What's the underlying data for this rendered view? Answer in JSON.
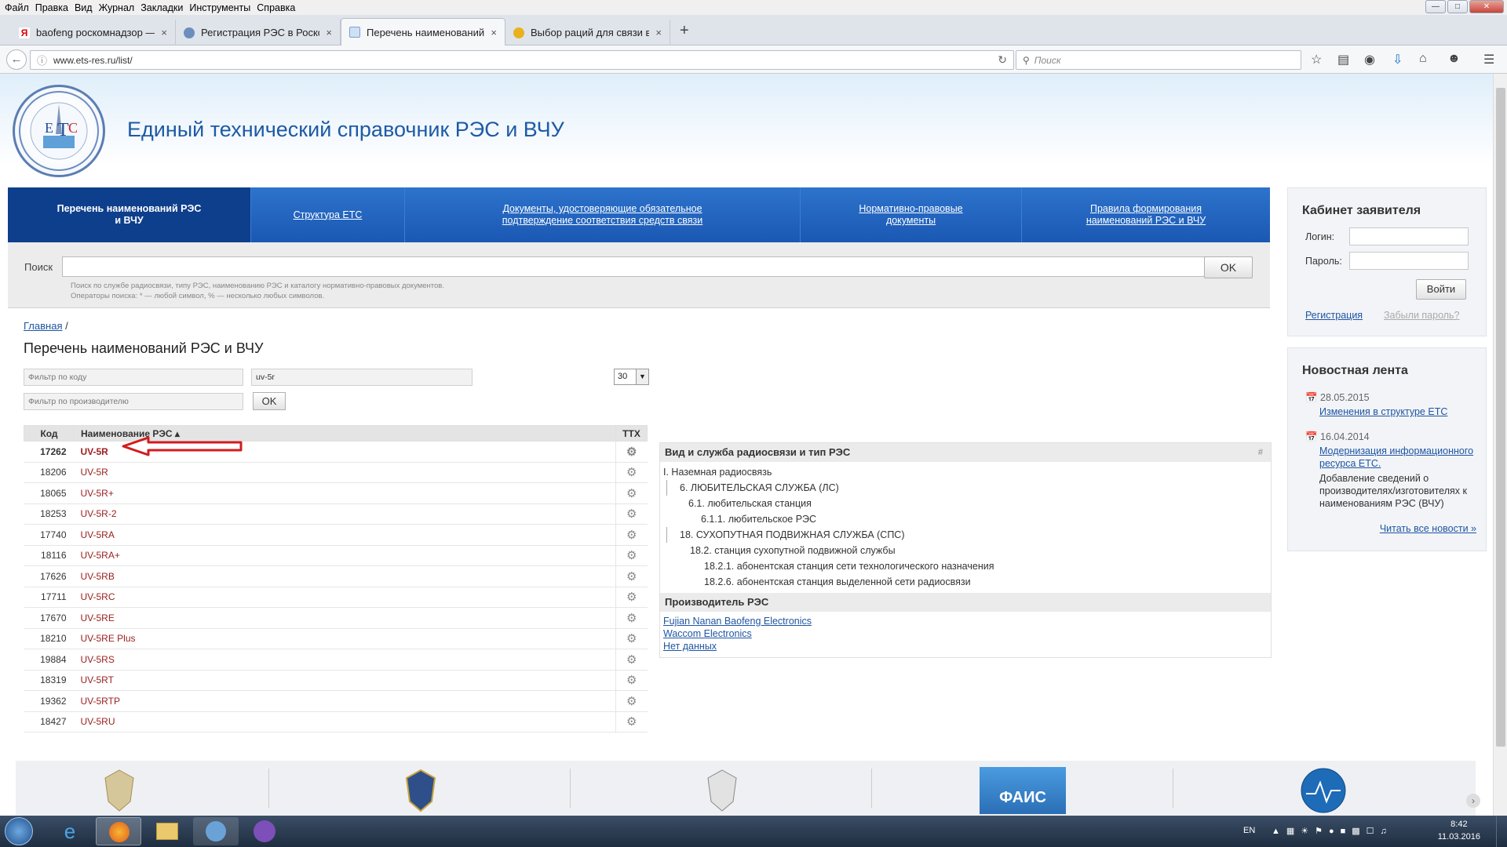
{
  "browser": {
    "menu": [
      "Файл",
      "Правка",
      "Вид",
      "Журнал",
      "Закладки",
      "Инструменты",
      "Справка"
    ],
    "tabs": [
      {
        "label": "baofeng роскомнадзор —...",
        "active": false
      },
      {
        "label": "Регистрация РЭС в Роско...",
        "active": false
      },
      {
        "label": "Перечень наименований ...",
        "active": true
      },
      {
        "label": "Выбор раций для связи в...",
        "active": false
      }
    ],
    "new_tab": "+",
    "url": "www.ets-res.ru/list/",
    "search_placeholder": "Поиск"
  },
  "site": {
    "title": "Единый технический справочник РЭС и ВЧУ",
    "nav": [
      {
        "label": "Перечень наименований РЭС и ВЧУ",
        "active": true
      },
      {
        "label": "Структура ЕТС",
        "active": false
      },
      {
        "label": "Документы, удостоверяющие обязательное подтверждение соответствия средств связи",
        "active": false
      },
      {
        "label": "Нормативно-правовые документы",
        "active": false
      },
      {
        "label": "Правила формирования наименований РЭС и ВЧУ",
        "active": false
      }
    ],
    "search": {
      "label": "Поиск",
      "button": "OK",
      "hint1": "Поиск по службе радиосвязи, типу РЭС, наименованию РЭС и каталогу нормативно-правовых документов.",
      "hint2": "Операторы поиска: * — любой символ, % — несколько любых символов."
    }
  },
  "breadcrumb": {
    "home": "Главная",
    "sep": "/"
  },
  "page_title": "Перечень наименований РЭС и ВЧУ",
  "filters": {
    "code_placeholder": "Фильтр по коду",
    "name_value": "uv-5r",
    "maker_placeholder": "Фильтр по производителю",
    "ok": "OK",
    "per_page": "30"
  },
  "table": {
    "headers": {
      "code": "Код",
      "name": "Наименование РЭС ▴",
      "ttx": "ТТХ"
    },
    "rows": [
      {
        "code": "17262",
        "name": "UV-5R"
      },
      {
        "code": "18206",
        "name": "UV-5R"
      },
      {
        "code": "18065",
        "name": "UV-5R+"
      },
      {
        "code": "18253",
        "name": "UV-5R-2"
      },
      {
        "code": "17740",
        "name": "UV-5RA"
      },
      {
        "code": "18116",
        "name": "UV-5RA+"
      },
      {
        "code": "17626",
        "name": "UV-5RB"
      },
      {
        "code": "17711",
        "name": "UV-5RC"
      },
      {
        "code": "17670",
        "name": "UV-5RE"
      },
      {
        "code": "18210",
        "name": "UV-5RE Plus"
      },
      {
        "code": "19884",
        "name": "UV-5RS"
      },
      {
        "code": "18319",
        "name": "UV-5RT"
      },
      {
        "code": "19362",
        "name": "UV-5RTP"
      },
      {
        "code": "18427",
        "name": "UV-5RU"
      }
    ],
    "gear_icon": "⚙"
  },
  "info": {
    "service_header": "Вид и служба радиосвязи и тип РЭС",
    "hash": "#",
    "tree": [
      "I. Наземная радиосвязь",
      "6. ЛЮБИТЕЛЬСКАЯ СЛУЖБА (ЛС)",
      "6.1. любительская станция",
      "6.1.1. любительское РЭС",
      "18. СУХОПУТНАЯ ПОДВИЖНАЯ СЛУЖБА (СПС)",
      "18.2. станция сухопутной подвижной службы",
      "18.2.1. абонентская станция сети технологического назначения",
      "18.2.6. абонентская станция выделенной сети радиосвязи"
    ],
    "maker_header": "Производитель РЭС",
    "makers": [
      "Fujian Nanan Baofeng Electronics",
      "Waccom Electronics",
      "Нет данных"
    ]
  },
  "cabinet": {
    "title": "Кабинет заявителя",
    "login_label": "Логин:",
    "password_label": "Пароль:",
    "login_button": "Войти",
    "register": "Регистрация",
    "forgot": "Забыли пароль?"
  },
  "news": {
    "title": "Новостная лента",
    "items": [
      {
        "date": "28.05.2015",
        "link": "Изменения в структуре ЕТС"
      },
      {
        "date": "16.04.2014",
        "link": "Модернизация информационного ресурса ЕТС.",
        "text": "Добавление сведений о производителях/изготовителях к наименованиям РЭС (ВЧУ)"
      }
    ],
    "all": "Читать все новости »"
  },
  "footer": {
    "logo_text": "ФАИС"
  },
  "taskbar": {
    "lang": "EN",
    "time": "8:42",
    "date": "11.03.2016"
  },
  "colors": {
    "nav_blue": "#1f60bd",
    "nav_active": "#0e3f8c",
    "link": "#1f55a3",
    "name_red": "#9b2020",
    "annotation_arrow": "#d21c1c"
  }
}
